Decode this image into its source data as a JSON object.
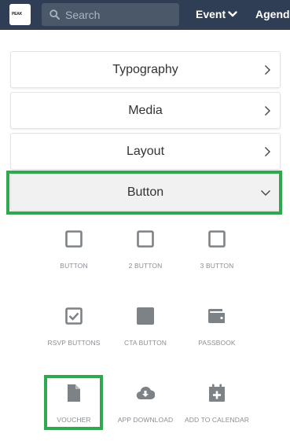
{
  "topbar": {
    "logo_text": "PEAK",
    "search_placeholder": "Search",
    "nav_event": "Event",
    "nav_agenda": "Agenda"
  },
  "panels": [
    {
      "label": "Typography",
      "state": "collapsed"
    },
    {
      "label": "Media",
      "state": "collapsed"
    },
    {
      "label": "Layout",
      "state": "collapsed"
    },
    {
      "label": "Button",
      "state": "expanded"
    }
  ],
  "widgets": [
    {
      "label": "BUTTON",
      "icon": "square-outline-icon"
    },
    {
      "label": "2 BUTTON",
      "icon": "square-outline-icon"
    },
    {
      "label": "3 BUTTON",
      "icon": "square-outline-icon"
    },
    {
      "label": "RSVP BUTTONS",
      "icon": "checkbox-icon"
    },
    {
      "label": "CTA BUTTON",
      "icon": "filled-square-icon"
    },
    {
      "label": "PASSBOOK",
      "icon": "wallet-icon"
    },
    {
      "label": "VOUCHER",
      "icon": "document-icon"
    },
    {
      "label": "APP DOWNLOAD",
      "icon": "cloud-download-icon"
    },
    {
      "label": "ADD TO CALENDAR",
      "icon": "calendar-plus-icon"
    }
  ],
  "colors": {
    "topbar": "#2f3e54",
    "highlight": "#2fa84f",
    "icon": "#7d8286"
  }
}
